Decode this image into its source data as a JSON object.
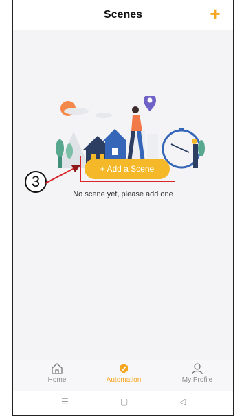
{
  "header": {
    "title": "Scenes",
    "add_icon": "plus-icon",
    "accent": "#f5a623"
  },
  "empty_state": {
    "message": "No scene yet, please add one"
  },
  "add_scene_button": {
    "label": "+ Add a Scene"
  },
  "annotation": {
    "number": "3",
    "color": "#d9262a"
  },
  "tabbar": {
    "tabs": [
      {
        "label": "Home",
        "icon": "home-icon",
        "active": false
      },
      {
        "label": "Automation",
        "icon": "automation-icon",
        "active": true
      },
      {
        "label": "My Profile",
        "icon": "profile-icon",
        "active": false
      }
    ]
  },
  "system_nav": {
    "menu": "☰",
    "home": "▢",
    "back": "◁"
  }
}
